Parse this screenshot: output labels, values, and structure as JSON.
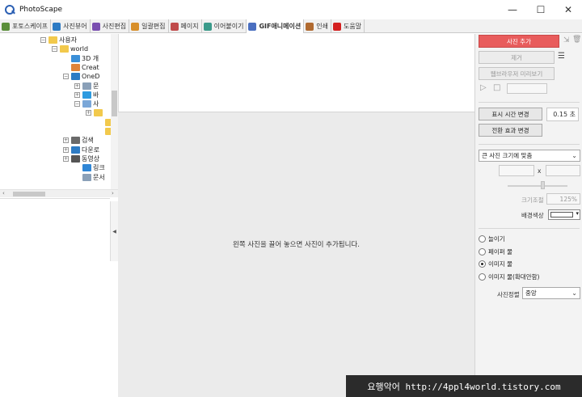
{
  "app": {
    "title": "PhotoScape"
  },
  "window_controls": {
    "minimize": "—",
    "maximize": "☐",
    "close": "✕"
  },
  "tabs": [
    {
      "label": "포토스케이프",
      "color": "#5b8f3a",
      "active": false
    },
    {
      "label": "사진뷰어",
      "color": "#2d7bc4",
      "active": false
    },
    {
      "label": "사진편집",
      "color": "#7a4fb0",
      "active": false
    },
    {
      "label": "일괄편집",
      "color": "#d88f2a",
      "active": false
    },
    {
      "label": "페이지",
      "color": "#c04a4a",
      "active": false
    },
    {
      "label": "이어붙이기",
      "color": "#3a9a8a",
      "active": false
    },
    {
      "label": "GIF애니메이션",
      "color": "#4a6fc0",
      "active": true
    },
    {
      "label": "인쇄",
      "color": "#b06a30",
      "active": false
    },
    {
      "label": "도움말",
      "color": "#d42020",
      "active": false
    }
  ],
  "tree": [
    {
      "label": "사용자",
      "toggle": "−",
      "icon": "folder"
    },
    {
      "label": "world",
      "toggle": "−",
      "icon": "folder"
    },
    {
      "label": "3D 개",
      "toggle": "",
      "icon": "cube"
    },
    {
      "label": "Creat",
      "toggle": "",
      "icon": "cloud"
    },
    {
      "label": "OneD",
      "toggle": "−",
      "icon": "onedrive"
    },
    {
      "label": "문",
      "toggle": "+",
      "icon": "doc"
    },
    {
      "label": "바",
      "toggle": "+",
      "icon": "desktop"
    },
    {
      "label": "사",
      "toggle": "−",
      "icon": "pictures"
    },
    {
      "label": "",
      "toggle": "+",
      "icon": "folder"
    },
    {
      "label": "",
      "toggle": "",
      "icon": "folder"
    },
    {
      "label": "",
      "toggle": "",
      "icon": "folder"
    },
    {
      "label": "검색",
      "toggle": "+",
      "icon": "search"
    },
    {
      "label": "다운로",
      "toggle": "+",
      "icon": "download"
    },
    {
      "label": "동영상",
      "toggle": "+",
      "icon": "video"
    },
    {
      "label": "링크",
      "toggle": "",
      "icon": "link"
    },
    {
      "label": "문서",
      "toggle": "",
      "icon": "doc"
    }
  ],
  "canvas": {
    "drop_hint": "왼쪽 사진을 끌어 놓으면 사진이 추가됩니다."
  },
  "right": {
    "add_photo": "사진 추가",
    "delete": "제거",
    "web_preview": "웹브라우저 미리보기",
    "display_time_btn": "표시 시간 변경",
    "display_time_value": "0.15 초",
    "transition_btn": "전환 효과 변경",
    "size_select": "큰 사진 크기에 맞춤",
    "dim_separator": "x",
    "zoom_label": "크기조절",
    "zoom_value": "125%",
    "bg_label": "배경색상",
    "radio_options": [
      {
        "label": "늘이기",
        "checked": false
      },
      {
        "label": "페이퍼 물",
        "checked": false
      },
      {
        "label": "이미지 물",
        "checked": true
      },
      {
        "label": "이미지 물(확대안함)",
        "checked": false
      }
    ],
    "align_label": "사진정렬",
    "align_value": "중앙"
  },
  "watermark": {
    "text": "요행악어 http://4ppl4world.tistory.com"
  },
  "colors": {
    "accent_red": "#e85c5c",
    "tab_active_bg": "#ffffff",
    "canvas_bg": "#ebebeb"
  }
}
